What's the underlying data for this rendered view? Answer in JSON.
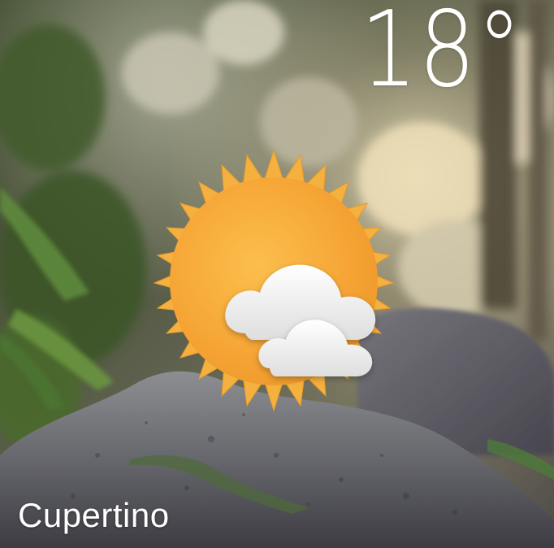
{
  "weather": {
    "temperature": "18°",
    "city": "Cupertino",
    "condition_icon": "partly-cloudy-sun-icon"
  },
  "colors": {
    "sun_rays": "#f5b13f",
    "sun_core": "#f7a83a",
    "cloud": "#f2f2f2",
    "text": "#ffffff"
  }
}
